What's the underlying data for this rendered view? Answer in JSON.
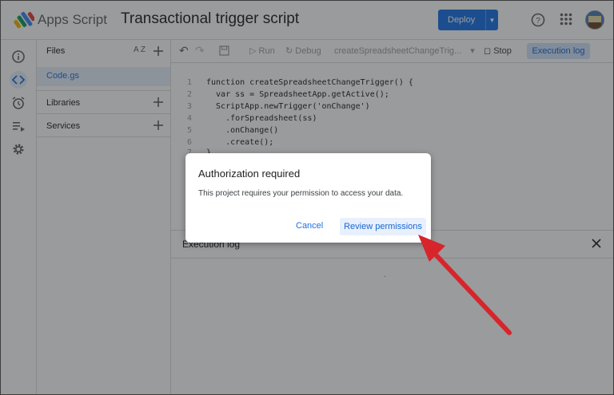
{
  "app": {
    "name": "Apps Script",
    "project_title": "Transactional trigger script",
    "deploy_label": "Deploy"
  },
  "header_icons": [
    "apps-script-logo-icon",
    "help-icon",
    "google-apps-icon",
    "avatar"
  ],
  "rail": {
    "items": [
      "overview-icon",
      "editor-icon",
      "triggers-icon",
      "executions-icon",
      "settings-icon"
    ],
    "active": "editor-icon"
  },
  "files_panel": {
    "title": "Files",
    "sort_label": "A Z",
    "files": [
      "Code.gs"
    ],
    "sections": [
      "Libraries",
      "Services"
    ]
  },
  "toolbar": {
    "run_label": "Run",
    "debug_label": "Debug",
    "function_name": "createSpreadsheetChangeTrig...",
    "stop_label": "Stop",
    "execution_log_label": "Execution log"
  },
  "editor": {
    "lines": [
      {
        "n": "1",
        "text": "function createSpreadsheetChangeTrigger() {"
      },
      {
        "n": "2",
        "text": "  var ss = SpreadsheetApp.getActive();"
      },
      {
        "n": "3",
        "text": "  ScriptApp.newTrigger('onChange')"
      },
      {
        "n": "4",
        "text": "    .forSpreadsheet(ss)"
      },
      {
        "n": "5",
        "text": "    .onChange()"
      },
      {
        "n": "6",
        "text": "    .create();"
      },
      {
        "n": "7",
        "text": "}"
      }
    ]
  },
  "log_panel": {
    "title": "Execution log"
  },
  "dialog": {
    "title": "Authorization required",
    "body": "This project requires your permission to access your data.",
    "cancel_label": "Cancel",
    "review_label": "Review permissions"
  },
  "colors": {
    "primary": "#1a73e8",
    "active_bg": "#e8f0fe",
    "annotation_arrow": "#d6252b"
  }
}
